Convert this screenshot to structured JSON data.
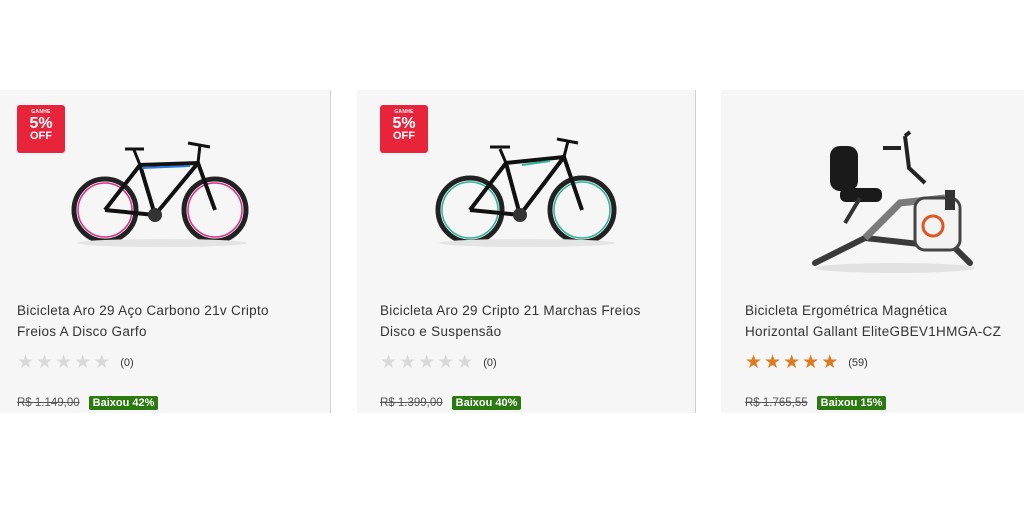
{
  "products": [
    {
      "badge": {
        "line1": "GANHE",
        "pct": "5%",
        "line3": "OFF"
      },
      "title_line1": "Bicicleta Aro 29 Aço Carbono 21v Cripto",
      "title_line2": "Freios A Disco Garfo",
      "rating": 0,
      "review_count": "(0)",
      "old_price": "R$ 1.149,00",
      "discount": "Baixou 42%",
      "image_icon": "mountain-bike-pink-blue"
    },
    {
      "badge": {
        "line1": "GANHE",
        "pct": "5%",
        "line3": "OFF"
      },
      "title_line1": "Bicicleta Aro 29 Cripto 21 Marchas Freios",
      "title_line2": "Disco e Suspensão",
      "rating": 0,
      "review_count": "(0)",
      "old_price": "R$ 1.399,00",
      "discount": "Baixou 40%",
      "image_icon": "mountain-bike-green"
    },
    {
      "title_line1": "Bicicleta Ergométrica Magnética",
      "title_line2": "Horizontal Gallant EliteGBEV1HMGA-CZ",
      "rating": 5,
      "review_count": "(59)",
      "old_price": "R$ 1.765,55",
      "discount": "Baixou 15%",
      "image_icon": "recumbent-exercise-bike"
    }
  ],
  "colors": {
    "badge": "#e8243b",
    "discount": "#2a7a10",
    "star_on": "#e07a1f",
    "star_off": "#d9d9d9"
  }
}
